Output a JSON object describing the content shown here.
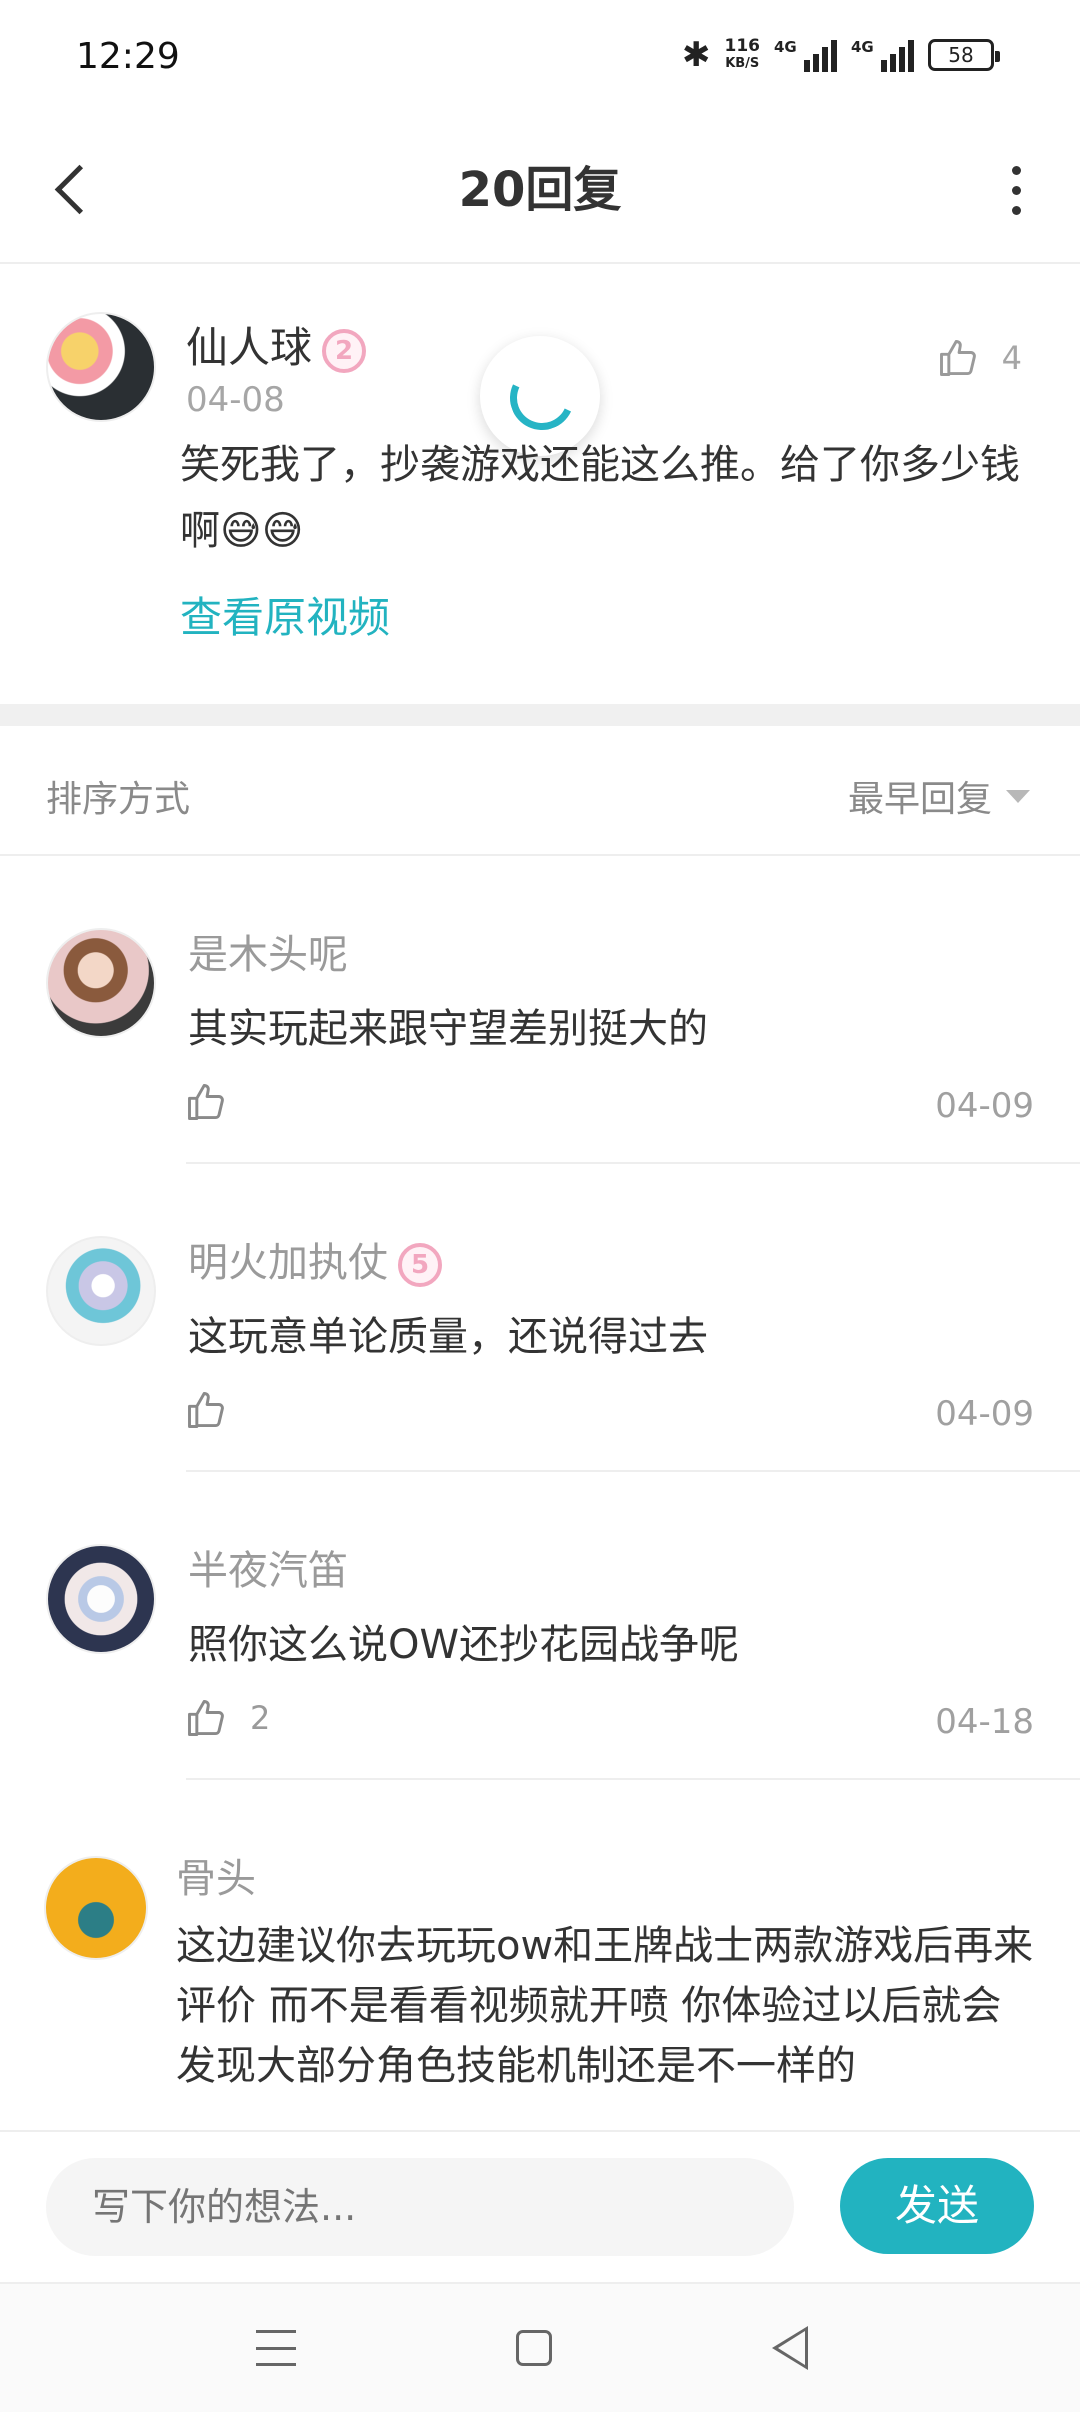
{
  "status_bar": {
    "time": "12:29",
    "net_speed_value": "116",
    "net_speed_unit": "KB/S",
    "signal1_label": "4G",
    "signal2_label": "4G",
    "battery": "58"
  },
  "header": {
    "title": "20回复"
  },
  "main_comment": {
    "username": "仙人球",
    "level": "2",
    "date": "04-08",
    "like_count": "4",
    "text": "笑死我了，抄袭游戏还能这么推。给了你多少钱啊😅😅",
    "view_video_label": "查看原视频"
  },
  "sort": {
    "label": "排序方式",
    "selected": "最早回复"
  },
  "replies": [
    {
      "username": "是木头呢",
      "text": "其实玩起来跟守望差别挺大的",
      "like_count": "",
      "date": "04-09"
    },
    {
      "username": "明火加执仗",
      "level": "5",
      "text": "这玩意单论质量，还说得过去",
      "like_count": "",
      "date": "04-09"
    },
    {
      "username": "半夜汽笛",
      "text": "照你这么说OW还抄花园战争呢",
      "like_count": "2",
      "date": "04-18"
    },
    {
      "username": "骨头",
      "text": "这边建议你去玩玩ow和王牌战士两款游戏后再来评价 而不是看看视频就开喷 你体验过以后就会发现大部分角色技能机制还是不一样的"
    }
  ],
  "input_bar": {
    "placeholder": "写下你的想法...",
    "send_label": "发送"
  },
  "colors": {
    "accent": "#22b3c0",
    "level_badge": "#f2a7bf"
  },
  "icons": [
    "bluetooth-icon",
    "back-arrow-icon",
    "more-vertical-icon",
    "thumb-up-icon",
    "caret-down-icon",
    "nav-menu-icon",
    "nav-home-icon",
    "nav-back-icon",
    "loading-spinner-icon"
  ]
}
